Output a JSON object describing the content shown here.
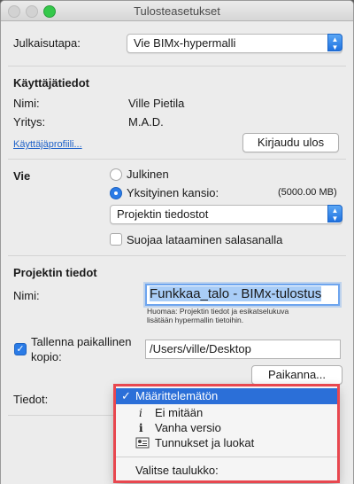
{
  "window": {
    "title": "Tulosteasetukset"
  },
  "publish": {
    "label": "Julkaisutapa:",
    "value": "Vie BIMx-hypermalli"
  },
  "user_info": {
    "heading": "Käyttäjätiedot",
    "name_label": "Nimi:",
    "name_value": "Ville Pietila",
    "company_label": "Yritys:",
    "company_value": "M.A.D.",
    "profile_link": "Käyttäjäprofiili...",
    "logout_button": "Kirjaudu ulos"
  },
  "export": {
    "label": "Vie",
    "public_option": "Julkinen",
    "private_option": "Yksityinen kansio:",
    "private_size": "(5000.00 MB)",
    "folder_value": "Projektin tiedostot",
    "protect_label": "Suojaa lataaminen salasanalla",
    "selected": "private",
    "protect_checked": false
  },
  "project": {
    "heading": "Projektin tiedot",
    "name_label": "Nimi:",
    "name_value": "Funkkaa_talo - BIMx-tulostus",
    "note_line1": "Huomaa: Projektin tiedot ja esikatselukuva",
    "note_line2": "lisätään hypermallin tietoihin."
  },
  "local_copy": {
    "label_line1": "Tallenna paikallinen",
    "label_line2": "kopio:",
    "checked": true,
    "path_value": "/Users/ville/Desktop",
    "locate_button": "Paikanna..."
  },
  "data_field": {
    "label": "Tiedot:"
  },
  "menu": {
    "items": [
      {
        "label": "Määrittelemätön",
        "checkmark": "✓",
        "selected": true
      },
      {
        "label": "Ei mitään",
        "icon": "info-icon"
      },
      {
        "label": "Vanha versio",
        "icon": "info-bold-icon"
      },
      {
        "label": "Tunnukset ja luokat",
        "icon": "id-card-icon"
      }
    ],
    "footer": "Valitse taulukko:"
  },
  "colors": {
    "accent": "#2a7be6",
    "menu_selected": "#2b6fd8",
    "highlight_border": "#e8474f",
    "link": "#1f62c9"
  }
}
